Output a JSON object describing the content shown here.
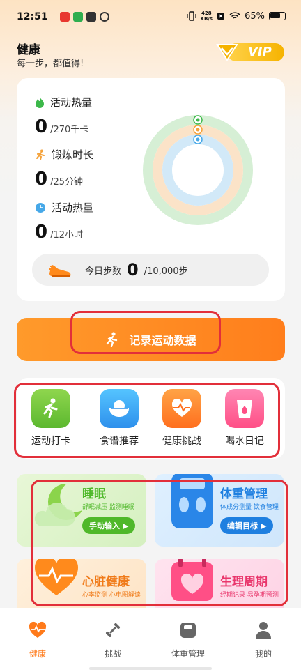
{
  "status_bar": {
    "time": "12:51",
    "net_speed_value": "428",
    "net_speed_unit": "KB/s",
    "battery": "65%"
  },
  "header": {
    "title": "健康",
    "subtitle": "每一步，都值得!",
    "vip_label": "VIP"
  },
  "stats": {
    "items": [
      {
        "label": "活动热量",
        "value": "0",
        "unit": "/270千卡",
        "icon": "flame-icon",
        "color": "#3cb84a"
      },
      {
        "label": "锻炼时长",
        "value": "0",
        "unit": "/25分钟",
        "icon": "runner-icon",
        "color": "#f5a23a"
      },
      {
        "label": "活动热量",
        "value": "0",
        "unit": "/12小时",
        "icon": "clock-icon",
        "color": "#46a8e8"
      }
    ],
    "rings": [
      {
        "name": "outer",
        "color": "#d6efd5",
        "progress": 0
      },
      {
        "name": "middle",
        "color": "#fbe3c8",
        "progress": 0
      },
      {
        "name": "inner",
        "color": "#d2e9f8",
        "progress": 0
      }
    ],
    "steps": {
      "label": "今日步数",
      "value": "0",
      "goal": "/10,000步"
    }
  },
  "record_button": {
    "label": "记录运动数据"
  },
  "quick_actions": [
    {
      "label": "运动打卡",
      "icon": "sport-checkin-icon",
      "color": "#6cc43c"
    },
    {
      "label": "食谱推荐",
      "icon": "rice-bowl-icon",
      "color": "#3fa7f2"
    },
    {
      "label": "健康挑战",
      "icon": "heart-pulse-icon",
      "color": "#ff7c2a"
    },
    {
      "label": "喝水日记",
      "icon": "water-cup-icon",
      "color": "#ff5c93"
    }
  ],
  "features": [
    {
      "title": "睡眠",
      "subtitle": "舒眠减压 监测睡眠",
      "button": "手动输入",
      "icon": "moon-cloud-icon",
      "accent": "#4fb82a"
    },
    {
      "title": "体重管理",
      "subtitle": "体成分测量 饮食管理",
      "button": "编辑目标",
      "icon": "scale-icon",
      "accent": "#1e7fe0"
    },
    {
      "title": "心脏健康",
      "subtitle": "心率监测 心电图解读",
      "icon": "heart-icon",
      "accent": "#f07a18"
    },
    {
      "title": "生理周期",
      "subtitle": "经期记录 易孕期预测",
      "icon": "calendar-heart-icon",
      "accent": "#e9356b"
    }
  ],
  "bottom_nav": [
    {
      "label": "健康",
      "icon": "heart-pulse-icon",
      "active": true
    },
    {
      "label": "挑战",
      "icon": "dumbbell-icon",
      "active": false
    },
    {
      "label": "体重管理",
      "icon": "scale-icon",
      "active": false
    },
    {
      "label": "我的",
      "icon": "person-icon",
      "active": false
    }
  ]
}
